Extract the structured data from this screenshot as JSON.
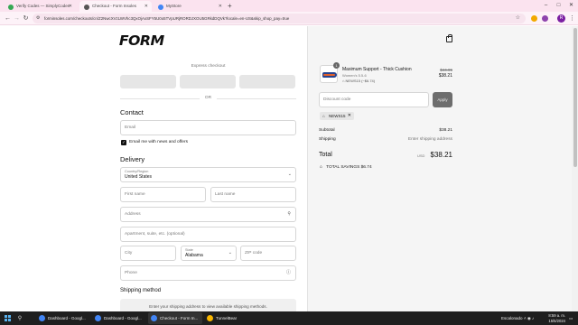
{
  "browser": {
    "tabs": [
      {
        "title": "Verify Codes — SimplyCodes",
        "color": "#35a853"
      },
      {
        "title": "Checkout - Form Insoles",
        "color": "#555555"
      },
      {
        "title": "MyStore",
        "color": "#4285f4"
      }
    ],
    "url": "forminsoles.com/checkouts/cn/Z2NwcXVzLWVhc3QxOjAxSFY5U0o5TVpURjRORDJXOU5GRkdDQVk?locale=en-US&skip_shop_pay=true",
    "profile_initial": "R"
  },
  "brand": {
    "logo": "FORM"
  },
  "express": {
    "label": "Express checkout",
    "or": "OR"
  },
  "contact": {
    "heading": "Contact",
    "email_placeholder": "Email",
    "news_label": "Email me with news and offers"
  },
  "delivery": {
    "heading": "Delivery",
    "country_label": "Country/Region",
    "country_value": "United States",
    "first_name": "First name",
    "last_name": "Last name",
    "address": "Address",
    "apartment": "Apartment, suite, etc. (optional)",
    "city": "City",
    "state_label": "State",
    "state_value": "Alabama",
    "zip": "ZIP code",
    "phone": "Phone"
  },
  "shipping": {
    "heading": "Shipping method",
    "note": "Enter your shipping address to view available shipping methods."
  },
  "order": {
    "quantity": "1",
    "product_name": "Maximum Support - Thick Cushion",
    "variant": "Women's 5.5-6",
    "code_applied": "NEWS15 (−$6.74)",
    "price_original": "$44.95",
    "price_current": "$38.21",
    "discount_placeholder": "Discount code",
    "apply_label": "Apply",
    "chip_code": "NEWS15",
    "subtotal_label": "Subtotal",
    "subtotal_value": "$38.21",
    "shipping_label": "Shipping",
    "shipping_value": "Enter shipping address",
    "total_label": "Total",
    "currency": "USD",
    "total_value": "$38.21",
    "savings_label": "TOTAL SAVINGS",
    "savings_value": "$6.74"
  },
  "taskbar": {
    "apps": [
      {
        "label": "Dashboard - Googl...",
        "color": "#4285f4"
      },
      {
        "label": "Dashboard - Googl...",
        "color": "#4285f4"
      },
      {
        "label": "Checkout - Form In...",
        "color": "#4285f4"
      },
      {
        "label": "TunnelBear",
        "color": "#f7b500"
      }
    ],
    "weather": "Escalonado",
    "time": "8:59 a. m.",
    "date": "15/5/2024"
  }
}
